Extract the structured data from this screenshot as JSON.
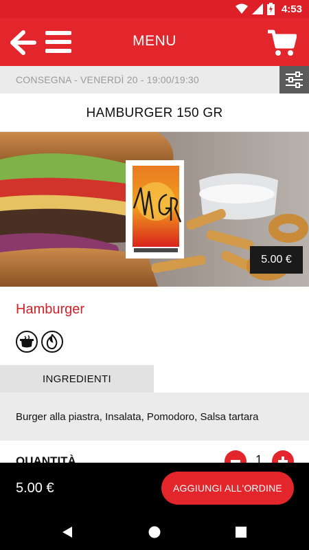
{
  "status": {
    "time": "4:53",
    "icons": [
      "wifi-icon",
      "signal-icon",
      "battery-charging-icon"
    ]
  },
  "appbar": {
    "title": "MENU",
    "icons": [
      "back-arrow-icon",
      "hamburger-menu-icon",
      "cart-icon"
    ]
  },
  "delivery": {
    "text": "CONSEGNA - VENERDÌ 20 - 19:00/19:30",
    "filter_icon": "sliders-icon"
  },
  "product": {
    "title": "HAMBURGER 150 GR",
    "price": "5.00 €",
    "category": "Hamburger",
    "badges": [
      "cooked-pot-icon",
      "fire-icon"
    ],
    "logo_text": "MGR",
    "tabs": [
      "INGREDIENTI"
    ],
    "ingredients": "Burger alla piastra, Insalata, Pomodoro, Salsa tartara",
    "quantity_label": "QUANTITÀ",
    "quantity": "1"
  },
  "order": {
    "total": "5.00 €",
    "add_label": "AGGIUNGI ALL'ORDINE"
  },
  "colors": {
    "primary": "#e2262b",
    "status_bar": "#dd2027",
    "dark": "#000000"
  }
}
